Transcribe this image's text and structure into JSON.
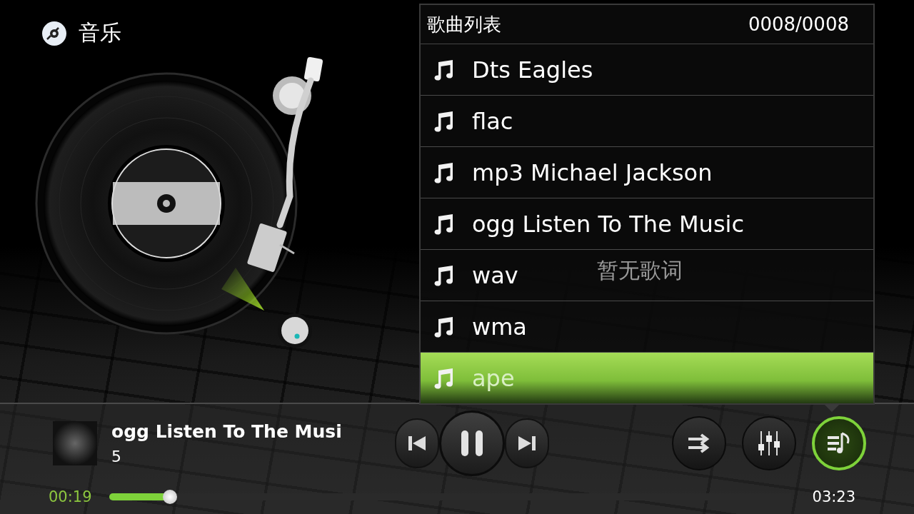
{
  "header": {
    "title": "音乐"
  },
  "lyrics": {
    "text": "暂无歌词"
  },
  "playlist": {
    "title": "歌曲列表",
    "counter": "0008/0008",
    "items": [
      {
        "title": "Dts Eagles",
        "selected": false
      },
      {
        "title": "flac",
        "selected": false
      },
      {
        "title": "mp3 Michael Jackson",
        "selected": false
      },
      {
        "title": "ogg Listen To The Music",
        "selected": false
      },
      {
        "title": "wav",
        "selected": false
      },
      {
        "title": "wma",
        "selected": false
      },
      {
        "title": "ape",
        "selected": true
      }
    ]
  },
  "now_playing": {
    "title": "ogg Listen To The Musi",
    "subtitle": "5",
    "elapsed": "00:19",
    "duration": "03:23",
    "progress": {
      "level": 0.09
    },
    "playing": true
  },
  "buttons": [
    {
      "kind": "order",
      "selected": false
    },
    {
      "kind": "equalizer",
      "selected": false
    },
    {
      "kind": "playlist",
      "selected": true
    }
  ]
}
